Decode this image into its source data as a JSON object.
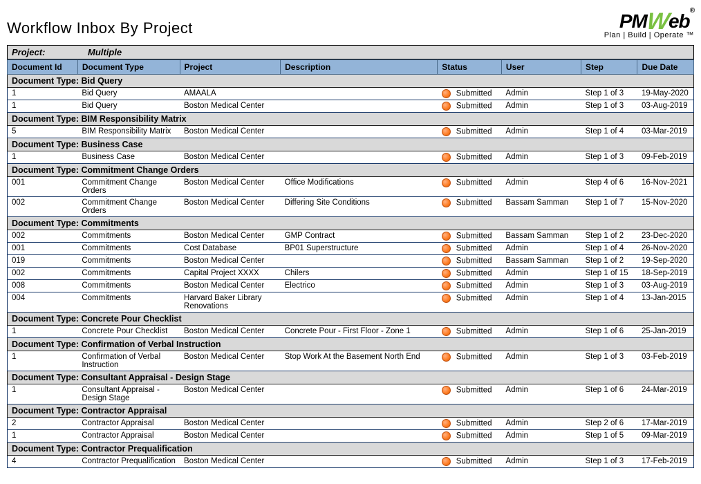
{
  "title": "Workflow Inbox By Project",
  "logo": {
    "prefix": "PM",
    "w": "W",
    "suffix": "eb",
    "reg": "®",
    "tagline": "Plan | Build | Operate ™"
  },
  "project_label": "Project:",
  "project_value": "Multiple",
  "columns": [
    "Document Id",
    "Document Type",
    "Project",
    "Description",
    "Status",
    "User",
    "Step",
    "Due Date"
  ],
  "group_prefix": "Document Type:  ",
  "groups": [
    {
      "name": "Bid Query",
      "rows": [
        {
          "id": "1",
          "type": "Bid Query",
          "project": "AMAALA",
          "desc": "",
          "status": "Submitted",
          "user": "Admin",
          "step": "Step 1 of 3",
          "due": "19-May-2020"
        },
        {
          "id": "1",
          "type": "Bid Query",
          "project": "Boston Medical Center",
          "desc": "",
          "status": "Submitted",
          "user": "Admin",
          "step": "Step 1 of 3",
          "due": "03-Aug-2019"
        }
      ]
    },
    {
      "name": "BIM Responsibility Matrix",
      "rows": [
        {
          "id": "5",
          "type": "BIM Responsibility Matrix",
          "project": "Boston Medical Center",
          "desc": "",
          "status": "Submitted",
          "user": "Admin",
          "step": "Step 1 of 4",
          "due": "03-Mar-2019"
        }
      ]
    },
    {
      "name": "Business Case",
      "rows": [
        {
          "id": "1",
          "type": "Business Case",
          "project": "Boston Medical Center",
          "desc": "",
          "status": "Submitted",
          "user": "Admin",
          "step": "Step 1 of 3",
          "due": "09-Feb-2019"
        }
      ]
    },
    {
      "name": "Commitment Change Orders",
      "rows": [
        {
          "id": "001",
          "type": "Commitment Change Orders",
          "project": "Boston Medical Center",
          "desc": "Office Modifications",
          "status": "Submitted",
          "user": "Admin",
          "step": "Step 4 of 6",
          "due": "16-Nov-2021"
        },
        {
          "id": "002",
          "type": "Commitment Change Orders",
          "project": "Boston Medical Center",
          "desc": "Differing Site Conditions",
          "status": "Submitted",
          "user": "Bassam Samman",
          "step": "Step 1 of 7",
          "due": "15-Nov-2020"
        }
      ]
    },
    {
      "name": "Commitments",
      "rows": [
        {
          "id": "002",
          "type": "Commitments",
          "project": "Boston Medical Center",
          "desc": "GMP Contract",
          "status": "Submitted",
          "user": "Bassam Samman",
          "step": "Step 1 of 2",
          "due": "23-Dec-2020"
        },
        {
          "id": "001",
          "type": "Commitments",
          "project": "Cost Database",
          "desc": "BP01 Superstructure",
          "status": "Submitted",
          "user": "Admin",
          "step": "Step 1 of 4",
          "due": "26-Nov-2020"
        },
        {
          "id": "019",
          "type": "Commitments",
          "project": "Boston Medical Center",
          "desc": "",
          "status": "Submitted",
          "user": "Bassam Samman",
          "step": "Step 1 of 2",
          "due": "19-Sep-2020"
        },
        {
          "id": "002",
          "type": "Commitments",
          "project": "Capital Project XXXX",
          "desc": "Chilers",
          "status": "Submitted",
          "user": "Admin",
          "step": "Step 1 of 15",
          "due": "18-Sep-2019"
        },
        {
          "id": "008",
          "type": "Commitments",
          "project": "Boston Medical Center",
          "desc": "Electrico",
          "status": "Submitted",
          "user": "Admin",
          "step": "Step 1 of 3",
          "due": "03-Aug-2019"
        },
        {
          "id": "004",
          "type": "Commitments",
          "project": "Harvard Baker Library Renovations",
          "desc": "",
          "status": "Submitted",
          "user": "Admin",
          "step": "Step 1 of 4",
          "due": "13-Jan-2015"
        }
      ]
    },
    {
      "name": "Concrete Pour Checklist",
      "rows": [
        {
          "id": "1",
          "type": "Concrete Pour Checklist",
          "project": "Boston Medical Center",
          "desc": "Concrete Pour - First Floor - Zone 1",
          "status": "Submitted",
          "user": "Admin",
          "step": "Step 1 of 6",
          "due": "25-Jan-2019"
        }
      ]
    },
    {
      "name": "Confirmation of Verbal Instruction",
      "rows": [
        {
          "id": "1",
          "type": "Confirmation of Verbal Instruction",
          "project": "Boston Medical Center",
          "desc": "Stop Work At the Basement North End",
          "status": "Submitted",
          "user": "Admin",
          "step": "Step 1 of 3",
          "due": "03-Feb-2019"
        }
      ]
    },
    {
      "name": "Consultant Appraisal - Design Stage",
      "rows": [
        {
          "id": "1",
          "type": "Consultant Appraisal - Design Stage",
          "project": "Boston Medical Center",
          "desc": "",
          "status": "Submitted",
          "user": "Admin",
          "step": "Step 1 of 6",
          "due": "24-Mar-2019"
        }
      ]
    },
    {
      "name": "Contractor Appraisal",
      "rows": [
        {
          "id": "2",
          "type": "Contractor Appraisal",
          "project": "Boston Medical Center",
          "desc": "",
          "status": "Submitted",
          "user": "Admin",
          "step": "Step 2 of 6",
          "due": "17-Mar-2019"
        },
        {
          "id": "1",
          "type": "Contractor Appraisal",
          "project": "Boston Medical Center",
          "desc": "",
          "status": "Submitted",
          "user": "Admin",
          "step": "Step 1 of 5",
          "due": "09-Mar-2019"
        }
      ]
    },
    {
      "name": "Contractor Prequalification",
      "rows": [
        {
          "id": "4",
          "type": "Contractor Prequalification",
          "project": "Boston Medical Center",
          "desc": "",
          "status": "Submitted",
          "user": "Admin",
          "step": "Step 1 of 3",
          "due": "17-Feb-2019"
        }
      ]
    }
  ]
}
